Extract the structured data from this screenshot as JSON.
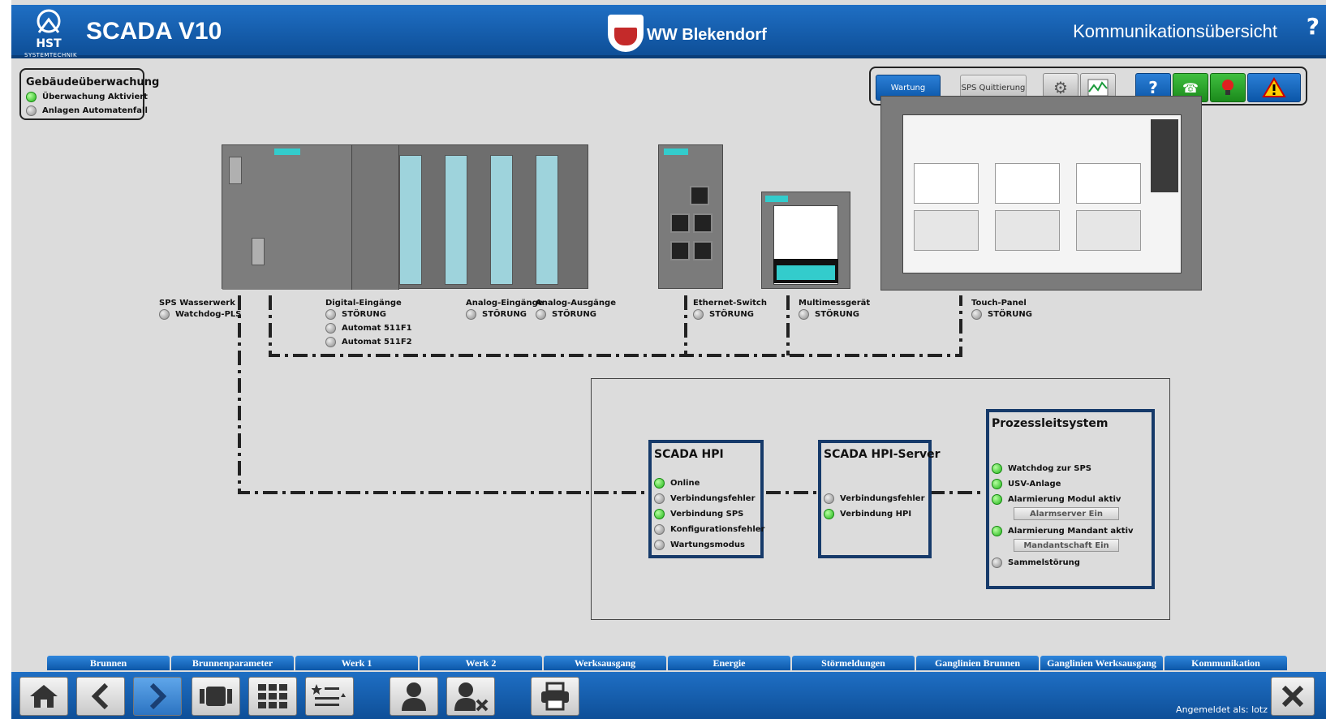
{
  "header": {
    "logo_text": "HST",
    "logo_sub": "SYSTEMTECHNIK",
    "app_title": "SCADA V10",
    "site_name": "WW Blekendorf",
    "page_name": "Kommunikationsübersicht",
    "help": "?"
  },
  "building": {
    "title": "Gebäudeüberwachung",
    "rows": [
      {
        "label": "Überwachung Aktiviert",
        "state": "green"
      },
      {
        "label": "Anlagen Automatenfall",
        "state": "gray"
      }
    ]
  },
  "toolbar": {
    "wartung": "Wartung",
    "sps_quittierung": "SPS Quittierung"
  },
  "devices": {
    "sps": {
      "title": "SPS Wasserwerk",
      "rows": [
        "Watchdog-PLS"
      ]
    },
    "digital": {
      "title": "Digital-Eingänge",
      "rows": [
        "STÖRUNG",
        "Automat 511F1",
        "Automat 511F2"
      ]
    },
    "analog_in": {
      "title": "Analog-Eingänge",
      "rows": [
        "STÖRUNG"
      ]
    },
    "analog_out": {
      "title": "Analog-Ausgänge",
      "rows": [
        "STÖRUNG"
      ]
    },
    "ethernet": {
      "title": "Ethernet-Switch",
      "rows": [
        "STÖRUNG"
      ]
    },
    "multi": {
      "title": "Multimessgerät",
      "rows": [
        "STÖRUNG"
      ]
    },
    "touch": {
      "title": "Touch-Panel",
      "rows": [
        "STÖRUNG"
      ]
    }
  },
  "scada_hpi": {
    "title": "SCADA HPI",
    "rows": [
      {
        "label": "Online",
        "state": "green"
      },
      {
        "label": "Verbindungsfehler",
        "state": "gray"
      },
      {
        "label": "Verbindung SPS",
        "state": "green"
      },
      {
        "label": "Konfigurationsfehler",
        "state": "gray"
      },
      {
        "label": "Wartungsmodus",
        "state": "gray"
      }
    ]
  },
  "hpi_server": {
    "title": "SCADA HPI-Server",
    "rows": [
      {
        "label": "Verbindungsfehler",
        "state": "gray"
      },
      {
        "label": "Verbindung HPI",
        "state": "green"
      }
    ]
  },
  "pls": {
    "title": "Prozessleitsystem",
    "watchdog": "Watchdog zur SPS",
    "usv": "USV-Anlage",
    "alarm_modul": "Alarmierung Modul aktiv",
    "alarmserver_btn": "Alarmserver Ein",
    "alarm_mandant": "Alarmierung Mandant aktiv",
    "mandant_btn": "Mandantschaft Ein",
    "sammel": "Sammelstörung"
  },
  "nav_tabs": [
    "Brunnen",
    "Brunnenparameter",
    "Werk 1",
    "Werk 2",
    "Werksausgang",
    "Energie",
    "Störmeldungen",
    "Ganglinien Brunnen",
    "Ganglinien Werksausgang",
    "Kommunikation"
  ],
  "bottom": {
    "logged_in": "Angemeldet als: lotz"
  },
  "colors": {
    "header_blue": "#1463b8",
    "led_green": "#21b619",
    "panel_border": "#163a6a"
  }
}
